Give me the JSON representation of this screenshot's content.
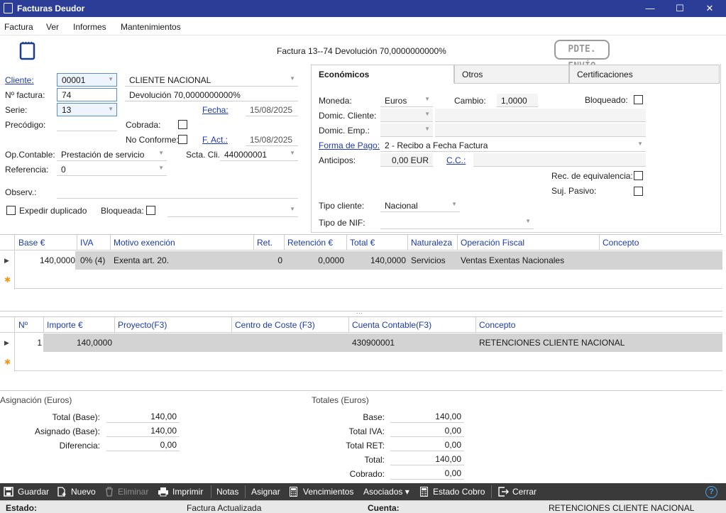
{
  "window": {
    "title": "Facturas Deudor",
    "minimize": "—",
    "maximize": "☐",
    "close": "✕"
  },
  "menu": [
    "Factura",
    "Ver",
    "Informes",
    "Mantenimientos"
  ],
  "header": {
    "invoice_caption": "Factura 13--74 Devolución 70,0000000000%",
    "stamp": "PDTE. ENVÍO"
  },
  "form": {
    "cliente_label": "Cliente:",
    "cliente_code": "00001",
    "cliente_name": "CLIENTE NACIONAL",
    "nfactura_label": "Nº factura:",
    "nfactura_value": "74",
    "nfactura_desc": "Devolución 70,0000000000%",
    "serie_label": "Serie:",
    "serie_value": "13",
    "fecha_label": "Fecha:",
    "fecha_value": "15/08/2025",
    "precodigo_label": "Precódigo:",
    "cobrada_label": "Cobrada:",
    "noconforme_label": "No Conforme:",
    "fact_label": "F. Act.:",
    "fact_value": "15/08/2025",
    "opcontable_label": "Op.Contable:",
    "opcontable_value": "Prestación de servicio",
    "sctacli_label": "Scta. Cli.",
    "sctacli_value": "440000001",
    "referencia_label": "Referencia:",
    "referencia_value": "0",
    "observ_label": "Observ.:",
    "expedir_label": "Expedir duplicado",
    "bloqueada_label": "Bloqueada:"
  },
  "tabs": [
    "Económicos",
    "Otros",
    "Certificaciones"
  ],
  "economicos": {
    "moneda_label": "Moneda:",
    "moneda_value": "Euros",
    "cambio_label": "Cambio:",
    "cambio_value": "1,0000",
    "bloqueado_label": "Bloqueado:",
    "domic_cliente_label": "Domic. Cliente:",
    "domic_emp_label": "Domic. Emp.:",
    "forma_pago_label": "Forma de Pago:",
    "forma_pago_value": "2 - Recibo a Fecha Factura",
    "anticipos_label": "Anticipos:",
    "anticipos_value": "0,00 EUR",
    "cc_label": "C.C.:",
    "rec_equiv_label": "Rec. de equivalencia:",
    "suj_pasivo_label": "Suj. Pasivo:",
    "tipo_cliente_label": "Tipo cliente:",
    "tipo_cliente_value": "Nacional",
    "tipo_nif_label": "Tipo de NIF:"
  },
  "grid1": {
    "headers": [
      "Base €",
      "IVA",
      "Motivo exención",
      "Ret.",
      "Retención €",
      "Total €",
      "Naturaleza",
      "Operación Fiscal",
      "Concepto"
    ],
    "row": [
      "140,0000",
      "0% (4)",
      "Exenta art. 20.",
      "0",
      "0,0000",
      "140,0000",
      "Servicios",
      "Ventas Exentas Nacionales",
      ""
    ]
  },
  "grid2": {
    "headers": [
      "Nº",
      "Importe €",
      "Proyecto(F3)",
      "Centro de Coste (F3)",
      "Cuenta Contable(F3)",
      "Concepto"
    ],
    "row": [
      "1",
      "140,0000",
      "",
      "",
      "430900001",
      "RETENCIONES CLIENTE NACIONAL"
    ]
  },
  "asignacion": {
    "title": "Asignación (Euros)",
    "total_base_label": "Total (Base):",
    "total_base": "140,00",
    "asignado_label": "Asignado (Base):",
    "asignado": "140,00",
    "diferencia_label": "Diferencia:",
    "diferencia": "0,00"
  },
  "totales": {
    "title": "Totales (Euros)",
    "base_label": "Base:",
    "base": "140,00",
    "total_iva_label": "Total IVA:",
    "total_iva": "0,00",
    "total_ret_label": "Total RET:",
    "total_ret": "0,00",
    "total_label": "Total:",
    "total": "140,00",
    "cobrado_label": "Cobrado:",
    "cobrado": "0,00"
  },
  "toolbar": {
    "guardar": "Guardar",
    "nuevo": "Nuevo",
    "eliminar": "Eliminar",
    "imprimir": "Imprimir",
    "notas": "Notas",
    "asignar": "Asignar",
    "vencimientos": "Vencimientos",
    "asociados": "Asociados ▾",
    "estado_cobro": "Estado Cobro",
    "cerrar": "Cerrar"
  },
  "status": {
    "estado_label": "Estado:",
    "estado_value": "Factura Actualizada",
    "cuenta_label": "Cuenta:",
    "cuenta_value": "RETENCIONES CLIENTE NACIONAL"
  }
}
